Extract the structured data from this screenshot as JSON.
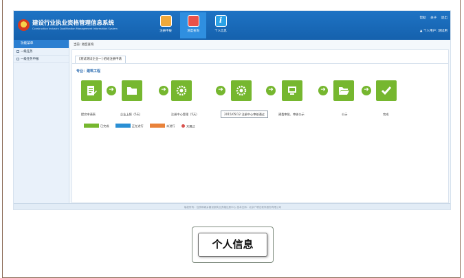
{
  "header": {
    "title": "建设行业执业资格管理信息系统",
    "subtitle": "Construction Industry Qualification Management Information System",
    "nav": [
      {
        "label": "注册申报",
        "icon": "form-doc-icon"
      },
      {
        "label": "进度查询",
        "icon": "progress-chat-icon"
      },
      {
        "label": "个人信息",
        "icon": "info-icon"
      }
    ],
    "links": [
      "帮助",
      "关于",
      "退出"
    ],
    "user": "个人用户: 测试用"
  },
  "sidebar": {
    "heading": "功能菜单",
    "items": [
      "一级任务",
      "一级任务申报"
    ]
  },
  "breadcrumb": "当前: 进度查询",
  "tab": {
    "label": "[测试测试企业一] 初始注册申请"
  },
  "profession": "专业：建筑工程",
  "steps": [
    {
      "label": "提交申请表",
      "icon": "document-edit-icon"
    },
    {
      "label": "企业上报（5天）",
      "icon": "folder-icon"
    },
    {
      "label": "注册中心受理（5天）",
      "icon": "gear-icon"
    },
    {
      "label": "",
      "icon": "gear-icon"
    },
    {
      "label": "建委审批、审核公示",
      "icon": "monitor-icon"
    },
    {
      "label": "公示",
      "icon": "open-folder-icon"
    },
    {
      "label": "完成",
      "icon": "check-icon"
    }
  ],
  "tooltip": "2015/05/12 注册中心审核通过",
  "legend": [
    {
      "label": "已完成",
      "color": "#76b72f"
    },
    {
      "label": "正在进行",
      "color": "#2a8fd4"
    },
    {
      "label": "未进行",
      "color": "#e9823a"
    },
    {
      "label": "未通过",
      "color": "#d9534f"
    }
  ],
  "footer": "版权所有：住房和城乡建设部执业资格注册中心    技术支持：北京广联达软件股份有限公司",
  "caption": "个人信息"
}
